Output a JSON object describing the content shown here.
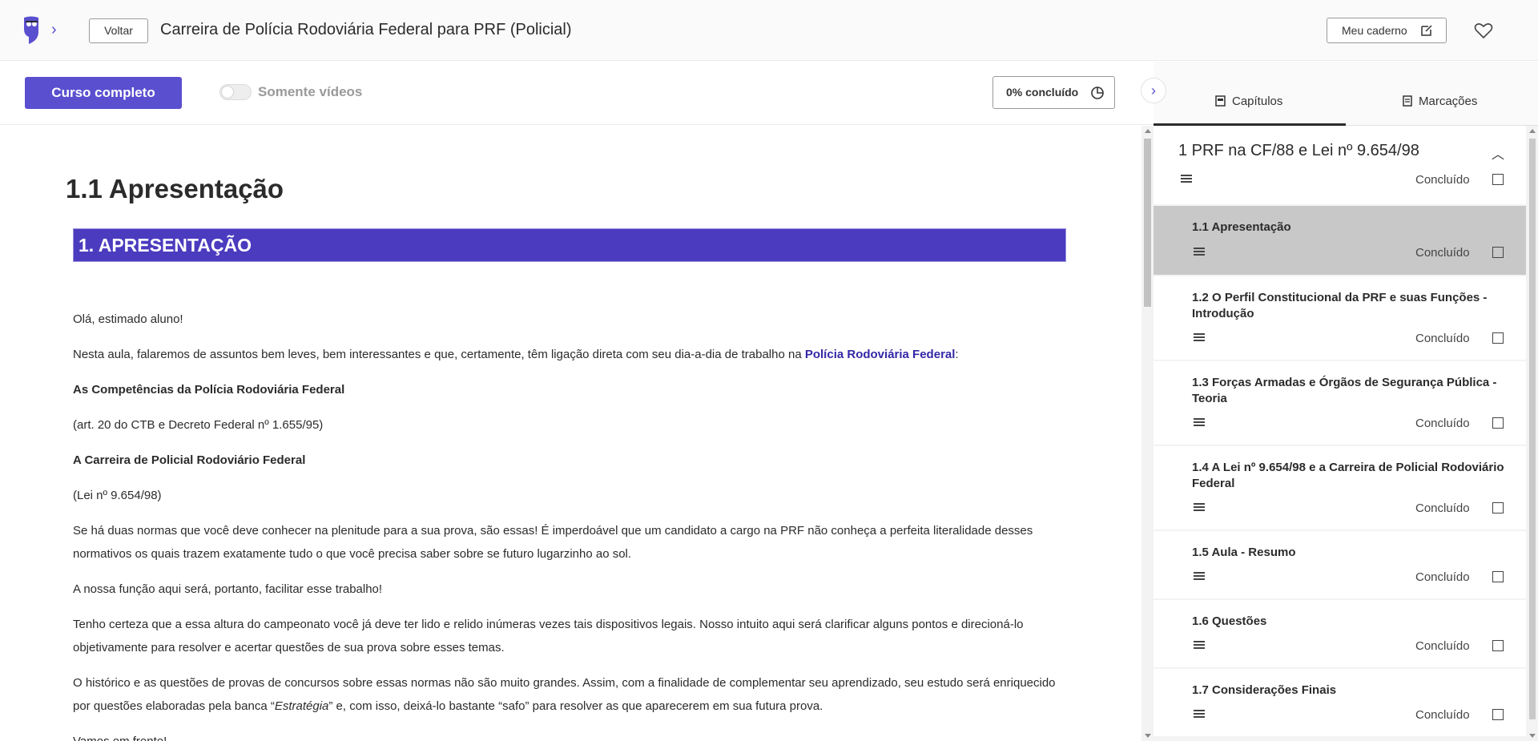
{
  "header": {
    "back_label": "Voltar",
    "course_title": "Carreira de Polícia Rodoviária Federal para PRF (Policial)",
    "notebook_label": "Meu caderno"
  },
  "controls": {
    "full_course_label": "Curso completo",
    "videos_only_label": "Somente vídeos",
    "progress_label": "0% concluído",
    "progress_fraction": 0
  },
  "lesson": {
    "title": "1.1 Apresentação",
    "banner": "1. APRESENTAÇÃO",
    "p1": "Olá, estimado aluno!",
    "p2_start": "Nesta aula, falaremos de assuntos bem leves, bem interessantes e que, certamente, têm ligação direta com seu dia-a-dia de trabalho na ",
    "p2_highlight": "Polícia Rodoviária Federal",
    "p2_end": ":",
    "h_comp": "As Competências da Polícia Rodoviária Federal",
    "ref_comp": "(art. 20 do CTB e Decreto Federal nº 1.655/95)",
    "h_carreira": "A Carreira de Policial Rodoviário Federal",
    "ref_carreira": "(Lei nº 9.654/98)",
    "p3": "Se há duas normas que você deve conhecer na plenitude para a sua prova, são essas! É imperdoável que um candidato a cargo na PRF não conheça a perfeita literalidade desses normativos os quais trazem exatamente tudo o que você precisa saber sobre se futuro lugarzinho ao sol.",
    "p4": "A nossa função aqui será, portanto, facilitar esse trabalho!",
    "p5": "Tenho certeza que a essa altura do campeonato você já deve ter lido e relido inúmeras vezes tais dispositivos legais. Nosso intuito aqui será clarificar alguns pontos e direcioná-lo objetivamente para resolver e acertar questões de sua prova sobre esses temas.",
    "p6_start": "O histórico e as questões de provas de concursos sobre essas normas não são muito grandes. Assim, com a finalidade de complementar seu aprendizado, seu estudo será enriquecido por questões elaboradas pela banca “",
    "p6_em": "Estratégia",
    "p6_end": "” e, com isso, deixá-lo bastante “safo” para resolver as que aparecerem em sua futura prova.",
    "p7": "Vamos em frente!"
  },
  "sidebar": {
    "tab_chapters": "Capítulos",
    "tab_bookmarks": "Marcações",
    "chapter_title": "1 PRF na CF/88 e Lei nº 9.654/98",
    "done_label": "Concluído",
    "items": [
      {
        "label": "1.1 Apresentação",
        "active": true
      },
      {
        "label": "1.2 O Perfil Constitucional da PRF e suas Funções - Introdução",
        "active": false
      },
      {
        "label": "1.3 Forças Armadas e Órgãos de Segurança Pública - Teoria",
        "active": false
      },
      {
        "label": "1.4 A Lei nº 9.654/98 e a Carreira de Policial Rodoviário Federal",
        "active": false
      },
      {
        "label": "1.5 Aula - Resumo",
        "active": false
      },
      {
        "label": "1.6 Questões",
        "active": false
      },
      {
        "label": "1.7 Considerações Finais",
        "active": false
      }
    ]
  },
  "colors": {
    "accent": "#5a4fcf",
    "banner": "#4b3bbf",
    "active_item": "#c8c8c8"
  }
}
